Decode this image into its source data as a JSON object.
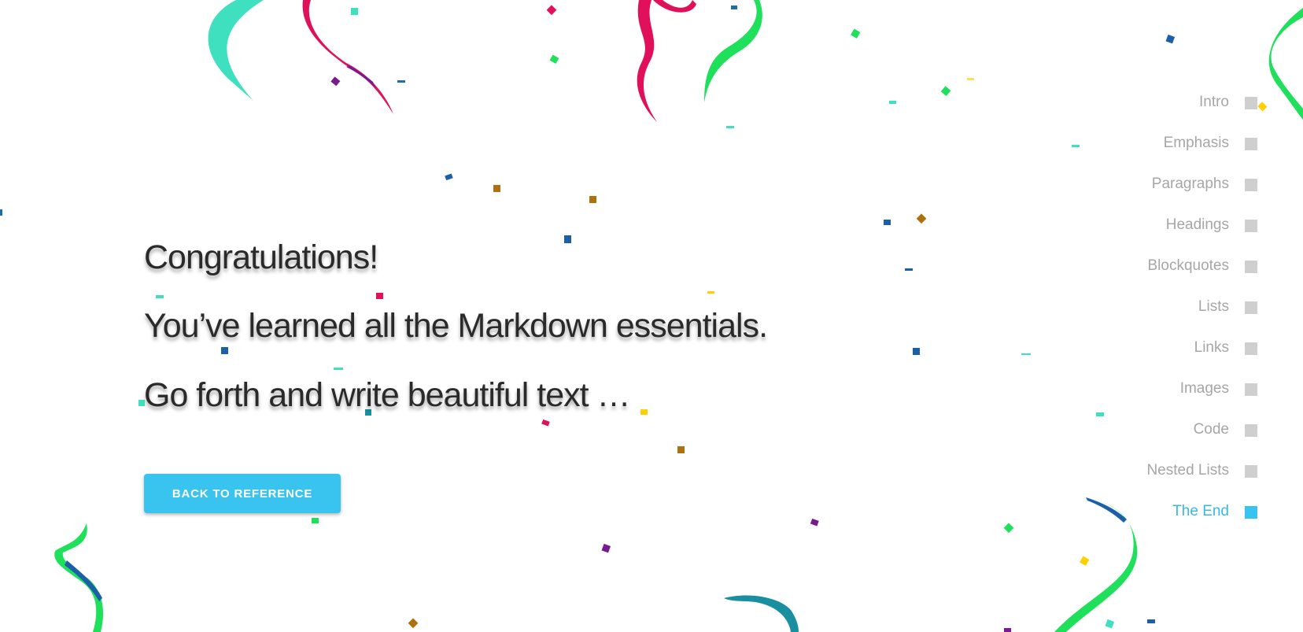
{
  "main": {
    "line1": "Congratulations!",
    "line2": "You’ve learned all the Markdown essentials.",
    "line3": "Go forth and write beautiful text …",
    "button_label": "BACK TO REFERENCE"
  },
  "nav": {
    "items": [
      {
        "label": "Intro"
      },
      {
        "label": "Emphasis"
      },
      {
        "label": "Paragraphs"
      },
      {
        "label": "Headings"
      },
      {
        "label": "Blockquotes"
      },
      {
        "label": "Lists"
      },
      {
        "label": "Links"
      },
      {
        "label": "Images"
      },
      {
        "label": "Code"
      },
      {
        "label": "Nested Lists"
      },
      {
        "label": "The End",
        "active": true
      }
    ]
  },
  "colors": {
    "accent": "#38c4ee",
    "heading_text": "#2a2a2a",
    "nav_text": "#a6a6a6",
    "nav_box": "#cfcfcf"
  }
}
